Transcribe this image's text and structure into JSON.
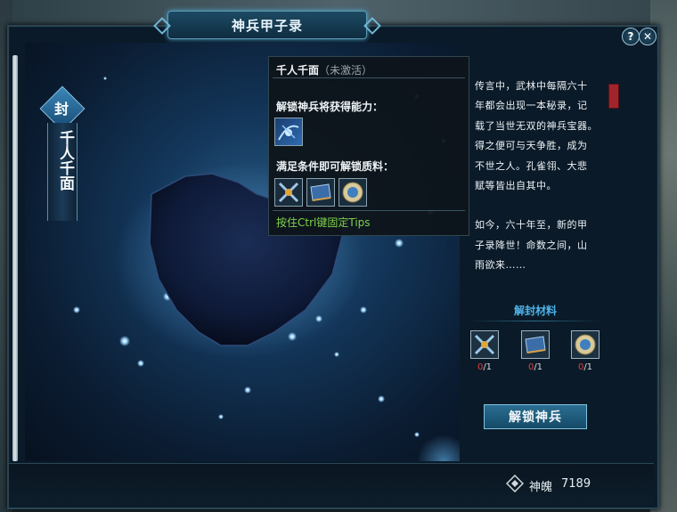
{
  "window": {
    "title": "神兵甲子录"
  },
  "controls": {
    "help": "?",
    "close": "✕"
  },
  "weapon": {
    "seal_char": "封",
    "name": "千人千面"
  },
  "tooltip": {
    "name": "千人千面",
    "status": "（未激活）",
    "ability_heading": "解锁神兵将获得能力：",
    "materials_heading": "满足条件即可解锁质料：",
    "hint": "按住Ctrl键固定Tips"
  },
  "story": {
    "lines": [
      "传言中，武林中每隔六十",
      "年都会出现一本秘录，记",
      "载了当世无双的神兵宝器。",
      "得之便可与天争胜，成为",
      "不世之人。孔雀翎、大悲",
      "赋等皆出自其中。",
      "",
      "如今，六十年至，新的甲",
      "子录降世！命数之间，山",
      "雨欲来……"
    ]
  },
  "materials": {
    "title": "解封材料",
    "items": [
      {
        "icon": "cross-blade-icon",
        "have": "0",
        "need": "/1"
      },
      {
        "icon": "scroll-icon",
        "have": "0",
        "need": "/1"
      },
      {
        "icon": "jade-disc-icon",
        "have": "0",
        "need": "/1"
      }
    ]
  },
  "unlock_button": "解锁神兵",
  "currency": {
    "label": "神魄",
    "value": "7189"
  },
  "colors": {
    "accent": "#4fb3ea",
    "hint": "#7fd24a",
    "zero_count": "#e2403a"
  }
}
